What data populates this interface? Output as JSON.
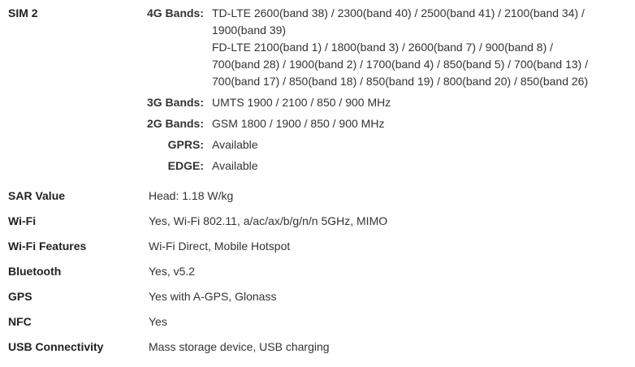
{
  "sim2": {
    "label": "SIM 2",
    "bands": {
      "4g": {
        "label": "4G Bands:",
        "lines": [
          "TD-LTE 2600(band 38) / 2300(band 40) / 2500(band 41) / 2100(band 34) /",
          "1900(band 39)",
          "FD-LTE 2100(band 1) / 1800(band 3) / 2600(band 7) / 900(band 8) /",
          "700(band 28) / 1900(band 2) / 1700(band 4) / 850(band 5) / 700(band 13) /",
          "700(band 17) / 850(band 18) / 850(band 19) / 800(band 20) / 850(band 26)"
        ]
      },
      "3g": {
        "label": "3G Bands:",
        "value": "UMTS 1900 / 2100 / 850 / 900 MHz"
      },
      "2g": {
        "label": "2G Bands:",
        "value": "GSM 1800 / 1900 / 850 / 900 MHz"
      },
      "gprs": {
        "label": "GPRS:",
        "value": "Available"
      },
      "edge": {
        "label": "EDGE:",
        "value": "Available"
      }
    }
  },
  "specs": [
    {
      "label": "SAR Value",
      "value": "Head: 1.18 W/kg"
    },
    {
      "label": "Wi-Fi",
      "value": "Yes, Wi-Fi 802.11, a/ac/ax/b/g/n/n 5GHz, MIMO"
    },
    {
      "label": "Wi-Fi Features",
      "value": "Wi-Fi Direct, Mobile Hotspot"
    },
    {
      "label": "Bluetooth",
      "value": "Yes, v5.2"
    },
    {
      "label": "GPS",
      "value": "Yes with A-GPS, Glonass"
    },
    {
      "label": "NFC",
      "value": "Yes"
    },
    {
      "label": "USB Connectivity",
      "value": "Mass storage device, USB charging"
    }
  ]
}
